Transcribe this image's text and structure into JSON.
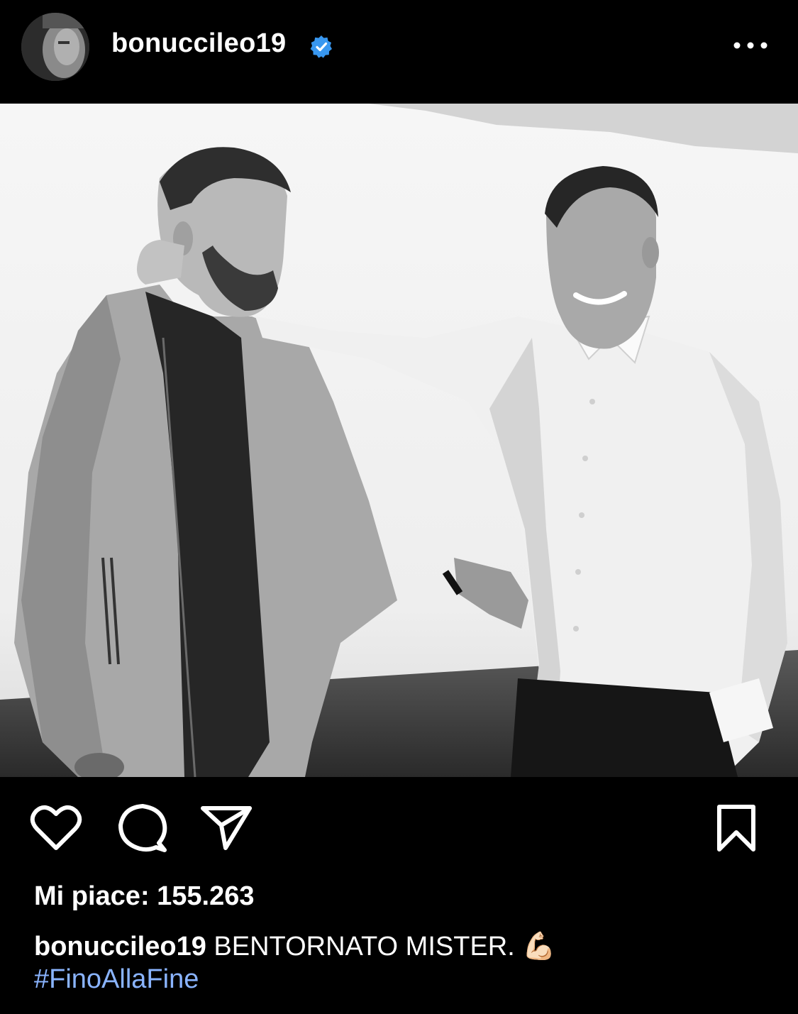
{
  "post": {
    "author": {
      "username": "bonuccileo19",
      "verified": true,
      "avatar_icon": "profile-photo"
    },
    "more_icon": "more-horizontal-icon",
    "image": {
      "kind": "black-and-white-photo",
      "description_icon": "post-photo",
      "background": "#f4f4f4"
    },
    "actions": {
      "like_icon": "heart-icon",
      "comment_icon": "comment-icon",
      "share_icon": "paper-plane-icon",
      "save_icon": "bookmark-icon"
    },
    "likes_text": "Mi piace: 155.263",
    "caption": {
      "username": "bonuccileo19",
      "text": "BENTORNATO MISTER.",
      "emoji": "💪🏻",
      "hashtag": "#FinoAllaFine"
    }
  },
  "colors": {
    "background": "#000000",
    "text": "#ffffff",
    "verified_badge": "#3897f0",
    "hashtag": "#8ab4ff"
  }
}
